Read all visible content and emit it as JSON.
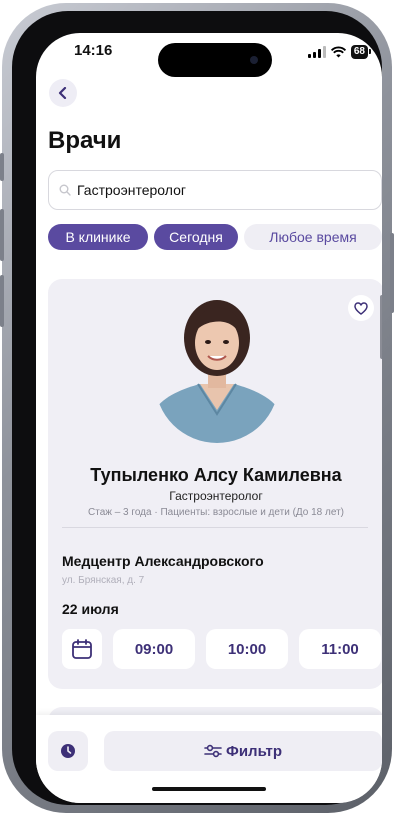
{
  "status_bar": {
    "time": "14:16",
    "battery": "68"
  },
  "header": {
    "title": "Врачи"
  },
  "search": {
    "value": "Гастроэнтеролог",
    "placeholder": ""
  },
  "chips": [
    {
      "label": "В клинике",
      "active": true
    },
    {
      "label": "Сегодня",
      "active": true
    },
    {
      "label": "Любое время",
      "active": false
    }
  ],
  "doctor": {
    "name": "Тупыленко Алсу Камилевна",
    "specialty": "Гастроэнтеролог",
    "meta": "Стаж – 3 года · Пациенты: взрослые и дети (До 18 лет)",
    "clinic": "Медцентр Александровского",
    "address": "ул. Брянская, д. 7",
    "date": "22 июля",
    "slots": [
      "09:00",
      "10:00",
      "11:00"
    ]
  },
  "bottom": {
    "filter_label": "Фильтр"
  },
  "colors": {
    "accent": "#5a4aa0",
    "accent_text": "#3d3077",
    "card_bg": "#f0eff5",
    "chip_bg": "#efeef4"
  },
  "icons": [
    "back-icon",
    "search-icon",
    "heart-icon",
    "calendar-icon",
    "clock-icon",
    "filter-icon"
  ]
}
